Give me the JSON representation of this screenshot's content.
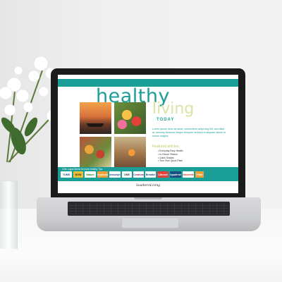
{
  "screen_page": {
    "title_healthy": "healthy",
    "title_living": "living",
    "title_today": "TODAY",
    "body_text": "Lorem ipsum dolor sit amet, consectetur adipi cing elit, sed diam ac nonumy eiusmod eleque tempore incidunt ut aliquam labore et dolore magna.",
    "featured_heading": "Featured articles:",
    "articles": [
      "Everyday Easy Health",
      "In-House Fitness",
      "Quick Snacks",
      "Your Own Quick Plate"
    ],
    "logos_label": "Click Logos Below for more Healthy Tips",
    "logos": [
      {
        "name": "TUMS",
        "bg": "#ffffff",
        "color": "#1a4d80"
      },
      {
        "name": "NOW",
        "bg": "#e8c03a",
        "color": "#3a2a10"
      },
      {
        "name": "Nature",
        "bg": "#ffffff",
        "color": "#2f7d36"
      },
      {
        "name": "Tropicana",
        "bg": "#f0a23a",
        "color": "#ffffff"
      },
      {
        "name": "Sensodyne",
        "bg": "#ffffff",
        "color": "#1a4d80"
      },
      {
        "name": "ONE",
        "bg": "#ffffff",
        "color": "#333333"
      },
      {
        "name": "Centrum",
        "bg": "#ffffff",
        "color": "#7a2c6b"
      },
      {
        "name": "Breathe",
        "bg": "#ffffff",
        "color": "#1a4d80"
      },
      {
        "name": "Citrucel",
        "bg": "#e2423a",
        "color": "#ffffff"
      },
      {
        "name": "Aquafresh",
        "bg": "#1a4d80",
        "color": "#ffffff"
      },
      {
        "name": "Nicorette",
        "bg": "#ffffff",
        "color": "#c8412e"
      },
      {
        "name": "Fiber",
        "bg": "#f0a23a",
        "color": "#ffffff"
      }
    ],
    "brand": "SouthernLiving"
  },
  "colors": {
    "teal": "#1a9e97",
    "lime": "#b3cf61",
    "pale_lime": "#d7e6a3"
  }
}
